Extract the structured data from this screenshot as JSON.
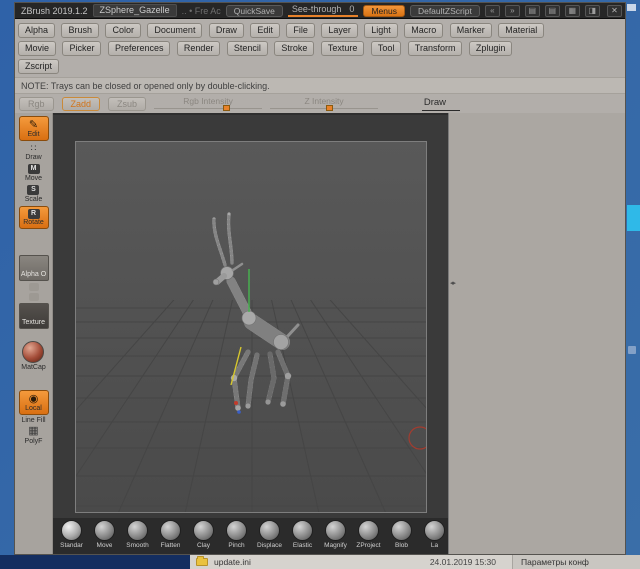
{
  "titlebar": {
    "app_title": "ZBrush 2019.1.2",
    "document_tab": "ZSphere_Gazelle",
    "extra": ".. • Fre  Ac",
    "quicksave": "QuickSave",
    "see_through_label": "See-through",
    "see_through_value": "0",
    "menus": "Menus",
    "default_zscript": "DefaultZScript",
    "icons": [
      "«",
      "»",
      "▤",
      "▤",
      "▦",
      "◨",
      "✕"
    ]
  },
  "menu": {
    "row1": [
      "Alpha",
      "Brush",
      "Color",
      "Document",
      "Draw",
      "Edit",
      "File",
      "Layer",
      "Light",
      "Macro",
      "Marker",
      "Material"
    ],
    "row2": [
      "Movie",
      "Picker",
      "Preferences",
      "Render",
      "Stencil",
      "Stroke",
      "Texture",
      "Tool",
      "Transform",
      "Zplugin"
    ],
    "row3": [
      "Zscript"
    ]
  },
  "note": "NOTE: Trays can be closed or opened only by double-clicking.",
  "controls": {
    "rgb": "Rgb",
    "zadd": "Zadd",
    "zsub": "Zsub",
    "rgb_intensity": "Rgb Intensity",
    "z_intensity": "Z Intensity",
    "draw": "Draw"
  },
  "tools": {
    "edit": "Edit",
    "edit_icon": "✎",
    "draw": "Draw",
    "draw_icon": "∷",
    "move": "Move",
    "move_icon": "M",
    "scale": "Scale",
    "scale_icon": "S",
    "rotate": "Rotate",
    "rotate_icon": "R",
    "alpha": "Alpha O",
    "texture": "Texture",
    "matcap": "MatCap",
    "local": "Local",
    "local_icon": "◉",
    "line_fill": "Line Fill",
    "polyf": "PolyF"
  },
  "brushes": [
    "Standar",
    "Move",
    "Smooth",
    "Flatten",
    "Clay",
    "Pinch",
    "Displace",
    "Elastic",
    "Magnify",
    "ZProject",
    "Blob",
    "La"
  ],
  "statusbar": {
    "file": "update.ini",
    "date": "24.01.2019 15:30",
    "panel": "Параметры конф"
  },
  "colors": {
    "accent_orange": "#e8822a",
    "desktop_blue": "#35659f",
    "canvas_dark": "#3a3a3a"
  }
}
